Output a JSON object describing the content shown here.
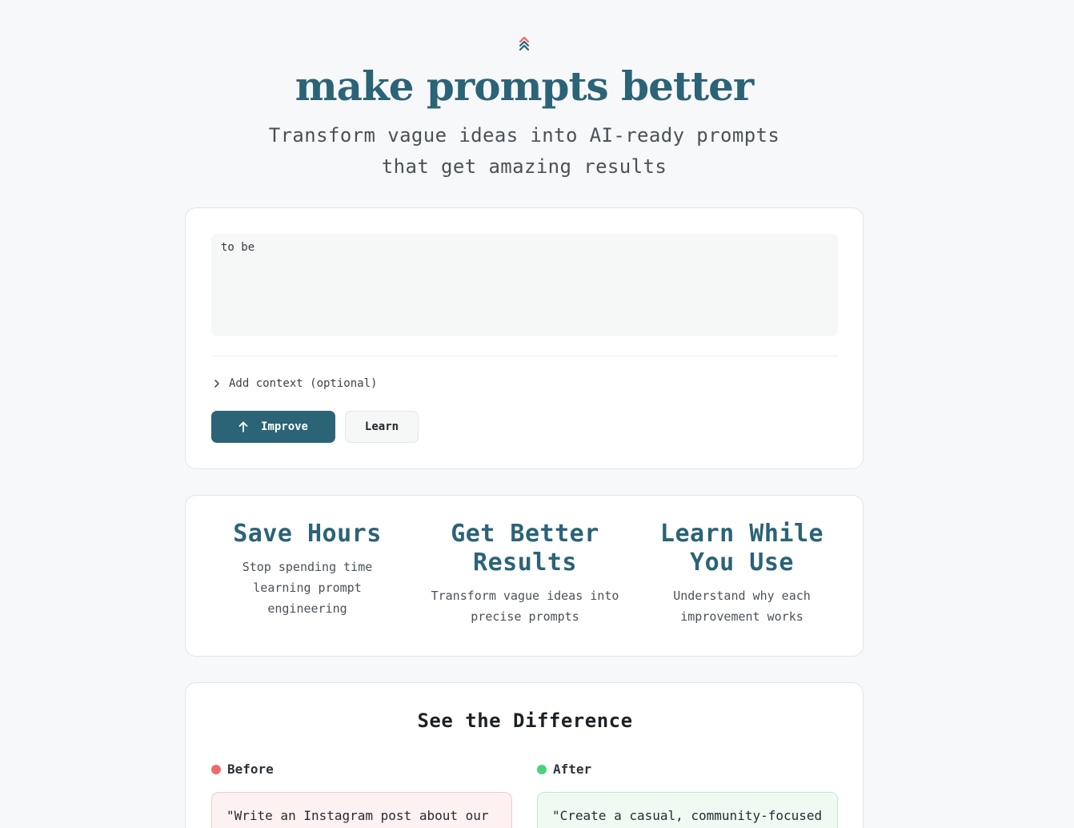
{
  "header": {
    "logo_icon": "double-chevron-up-icon",
    "title": "make prompts better",
    "subtitle_line1": "Transform vague ideas into AI-ready prompts",
    "subtitle_line2": "that get amazing results"
  },
  "input": {
    "value": "to be",
    "context_toggle_label": "Add context (optional)",
    "improve_label": "Improve",
    "learn_label": "Learn"
  },
  "features": [
    {
      "title": "Save Hours",
      "description": "Stop spending time learning prompt engineering"
    },
    {
      "title": "Get Better Results",
      "description": "Transform vague ideas into precise prompts"
    },
    {
      "title": "Learn While You Use",
      "description": "Understand why each improvement works"
    }
  ],
  "difference": {
    "title": "See the Difference",
    "before_label": "Before",
    "after_label": "After",
    "before_text": "\"Write an Instagram post about our",
    "after_text": "\"Create a casual, community-focused"
  },
  "colors": {
    "accent": "#2b6377",
    "before_dot": "#ef6b6b",
    "after_dot": "#4bd27d",
    "logo_top": "#e96a5a"
  }
}
